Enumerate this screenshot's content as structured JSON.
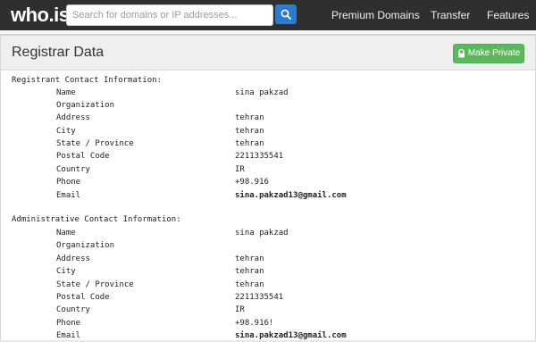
{
  "header": {
    "logo": "who.is",
    "search_placeholder": "Search for domains or IP addresses...",
    "nav": [
      "Premium Domains",
      "Transfer",
      "Features"
    ]
  },
  "panel": {
    "title": "Registrar Data",
    "make_private": "Make Private",
    "accent_color": "#5cb85c"
  },
  "sections": [
    {
      "heading": "Registrant Contact Information:",
      "rows": [
        {
          "label": "Name",
          "value": "sina pakzad"
        },
        {
          "label": "Organization",
          "value": ""
        },
        {
          "label": "Address",
          "value": "tehran"
        },
        {
          "label": "City",
          "value": "tehran"
        },
        {
          "label": "State / Province",
          "value": "tehran"
        },
        {
          "label": "Postal Code",
          "value": "2211335541"
        },
        {
          "label": "Country",
          "value": "IR"
        },
        {
          "label": "Phone",
          "value": "+98.916"
        },
        {
          "label": "Email",
          "value": "sina.pakzad13@gmail.com"
        }
      ]
    },
    {
      "heading": "Administrative Contact Information:",
      "rows": [
        {
          "label": "Name",
          "value": "sina pakzad"
        },
        {
          "label": "Organization",
          "value": ""
        },
        {
          "label": "Address",
          "value": "tehran"
        },
        {
          "label": "City",
          "value": "tehran"
        },
        {
          "label": "State / Province",
          "value": "tehran"
        },
        {
          "label": "Postal Code",
          "value": "2211335541"
        },
        {
          "label": "Country",
          "value": "IR"
        },
        {
          "label": "Phone",
          "value": "+98.916!"
        },
        {
          "label": "Email",
          "value": "sina.pakzad13@gmail.com"
        }
      ]
    }
  ]
}
